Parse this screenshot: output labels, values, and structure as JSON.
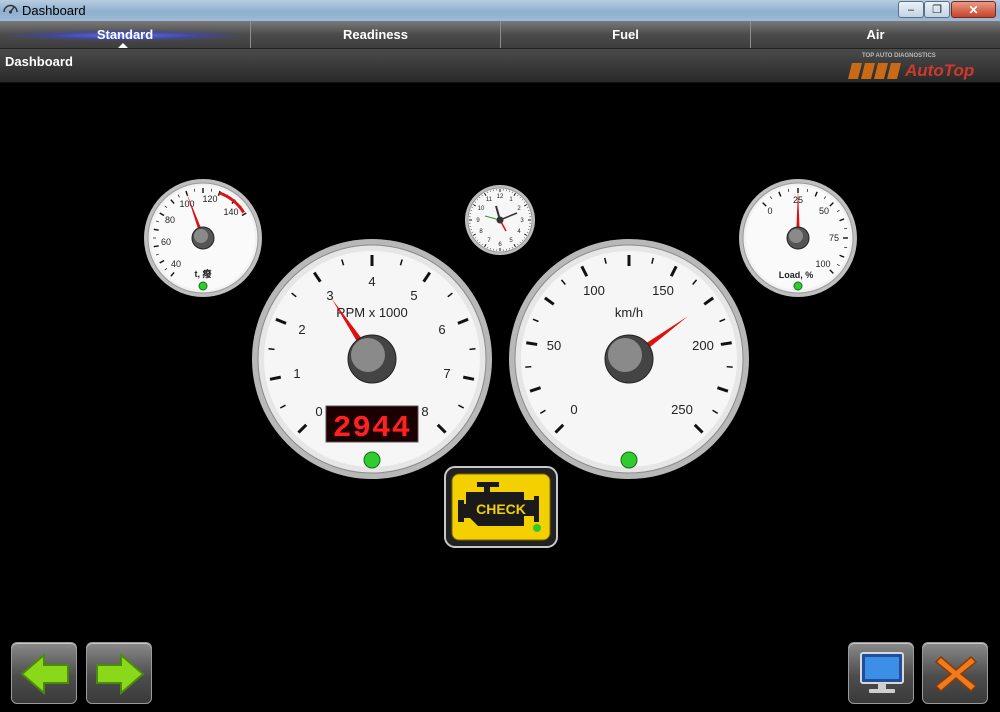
{
  "window": {
    "title": "Dashboard",
    "minimize": "‒",
    "restore": "❐",
    "close": "✕"
  },
  "tabs": [
    {
      "label": "Standard",
      "active": true
    },
    {
      "label": "Readiness",
      "active": false
    },
    {
      "label": "Fuel",
      "active": false
    },
    {
      "label": "Air",
      "active": false
    }
  ],
  "subheader": {
    "title": "Dashboard"
  },
  "logo": {
    "small_text": "TOP AUTO DIAGNOSTICS",
    "brand": "AutoTop"
  },
  "gauges": {
    "temp": {
      "labels": [
        "40",
        "60",
        "80",
        "100",
        "120",
        "140"
      ],
      "unit": "t, 癈",
      "min": 40,
      "max": 140,
      "value": 100
    },
    "clock": {
      "labels": [
        "12",
        "1",
        "2",
        "3",
        "4",
        "5",
        "6",
        "7",
        "8",
        "9",
        "10",
        "11"
      ]
    },
    "load": {
      "labels": [
        "0",
        "25",
        "50",
        "75",
        "100"
      ],
      "unit": "Load, %",
      "min": 0,
      "max": 100,
      "value": 25
    },
    "rpm": {
      "labels": [
        "0",
        "1",
        "2",
        "3",
        "4",
        "5",
        "6",
        "7",
        "8"
      ],
      "unit": "RPM x 1000",
      "min": 0,
      "max": 8,
      "value": 3,
      "display": "2944"
    },
    "speed": {
      "labels": [
        "0",
        "50",
        "100",
        "150",
        "200",
        "250"
      ],
      "unit": "km/h",
      "min": 0,
      "max": 250,
      "value": 175
    }
  },
  "check_engine": {
    "label": "CHECK"
  },
  "colors": {
    "needle": "#e01010",
    "led": "#2ecc2e",
    "check_yellow": "#f5d000",
    "digits": "#ff2020"
  },
  "buttons": {
    "back": "arrow-left-icon",
    "forward": "arrow-right-icon",
    "monitor": "monitor-icon",
    "close": "close-x-icon"
  }
}
